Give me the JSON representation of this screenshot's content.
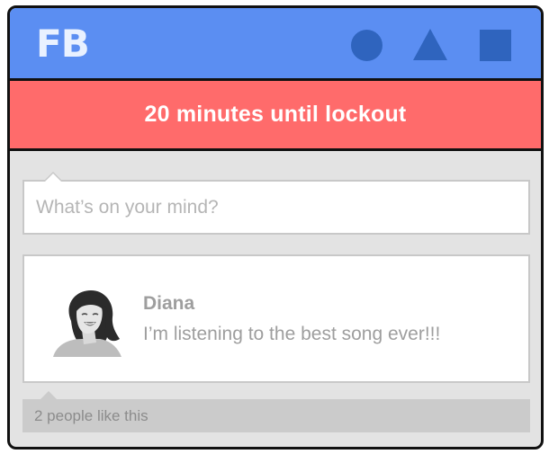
{
  "header": {
    "logo": "FB",
    "nav_icons": [
      "circle-icon",
      "triangle-icon",
      "square-icon"
    ],
    "background": "#5b8ef2",
    "icon_color": "#2f64be"
  },
  "banner": {
    "text": "20 minutes until lockout",
    "background": "#ff6b6b"
  },
  "composer": {
    "placeholder": "What’s on your mind?"
  },
  "post": {
    "author": "Diana",
    "text": "I’m listening to the best song ever!!!",
    "avatar_icon": "user-avatar"
  },
  "likes": {
    "text": "2 people like this"
  }
}
